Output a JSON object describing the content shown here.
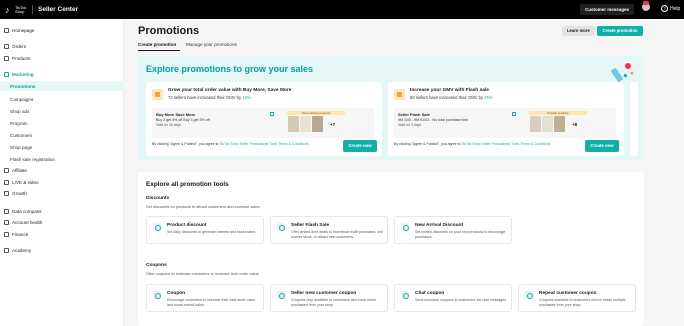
{
  "header": {
    "logo_text": "TikTok Shop",
    "brand": "Seller Center",
    "customer_messages": "Customer messages",
    "help": "Help",
    "icons": [
      "tiktok-logo-icon",
      "avatar-icon",
      "help-icon"
    ],
    "accent": "#fe2c55"
  },
  "sidebar": {
    "homepage": "Homepage",
    "orders": "Orders",
    "products": "Products",
    "marketing": "Marketing",
    "promotions": "Promotions",
    "campaigns": "Campaigns",
    "shop_ads": "Shop ads",
    "program": "Program",
    "customers": "Customers",
    "shop_page": "Shop page",
    "flash_sale_registration": "Flash sale registration",
    "affiliate": "Affiliate",
    "live_video": "LIVE & video",
    "growth": "Growth",
    "data_compass": "Data compass",
    "account_health": "Account health",
    "finance": "Finance",
    "academy": "Academy"
  },
  "page": {
    "title": "Promotions",
    "learn_more": "Learn more",
    "create_promotion": "Create promotion",
    "tabs": [
      "Create promotion",
      "Manage your promotions"
    ],
    "accent": "#10b0a5"
  },
  "banner": {
    "title": "Explore promotions to grow your sales",
    "cards": [
      {
        "title": "Grow your total order value with Buy More, Save More",
        "sub_prefix": "72 sellers have increased their GMV by",
        "sub_pct": "16%",
        "inner_title": "Buy More Save More",
        "inner_line": "Buy 2 get 4% off   Buy 3 get 5% off",
        "inner_line2": "Valid for 30 days",
        "products_label": "Store existing products",
        "more": "+7",
        "foot_prefix": "By clicking \"Agree & Publish\", you agree to",
        "foot_link": "TikTok Shop Seller Promotional Tools Terms & Conditions",
        "button": "Create now"
      },
      {
        "title": "Increase your GMV with Flash sale",
        "sub_prefix": "50 sellers have increased their GMV by",
        "sub_pct": "25%",
        "inner_title": "Seller Flash Sale",
        "inner_line": "9M 1/00 - 9M 01/03 - No total purchase limit",
        "inner_line2": "Valid for 3 days",
        "products_label": "Popular products",
        "more": "+8",
        "foot_prefix": "By clicking \"Agree & Publish\", you agree to",
        "foot_link": "TikTok Shop Seller Promotional Tools Terms & Conditions",
        "button": "Create now"
      }
    ]
  },
  "tools": {
    "title": "Explore all promotion tools",
    "discounts": {
      "title": "Discounts",
      "subtitle": "Set discounts on products to attract customers and increase sales",
      "items": [
        {
          "title": "Product discount",
          "desc": "Set daily discounts to generate interest and boost sales."
        },
        {
          "title": "Seller Flash Sale",
          "desc": "Offer limited-time deals to incentivize swift purchases, sell excess stock, or attract new customers."
        },
        {
          "title": "New Arrival Discount",
          "desc": "Set limited discounts on your new products to encourage purchases."
        }
      ]
    },
    "coupons": {
      "title": "Coupons",
      "subtitle": "Offer coupons to motivate customers to increase their order value",
      "items": [
        {
          "title": "Coupon",
          "desc": "Encourage customers to increase their total order value and boost overall sales."
        },
        {
          "title": "Seller new customer coupon",
          "desc": "Coupons only available to customers who have never purchased from your shop."
        },
        {
          "title": "Chat coupon",
          "desc": "Send exclusive coupons to customers via chat messages."
        },
        {
          "title": "Repeat customer coupon",
          "desc": "Coupons available to customers who've made multiple purchases from your shop."
        }
      ]
    }
  }
}
